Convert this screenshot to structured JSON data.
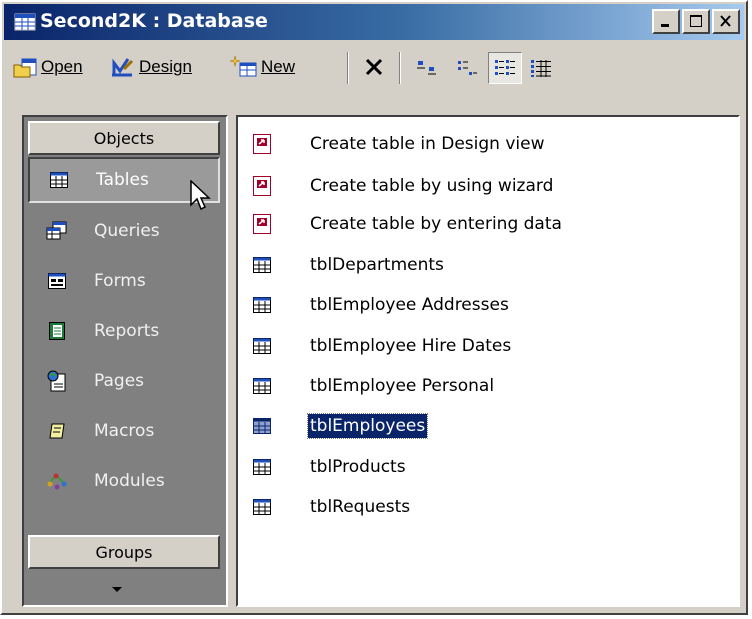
{
  "window": {
    "title": "Second2K : Database",
    "caption_buttons": [
      "minimize-icon",
      "maximize-icon",
      "close-icon"
    ]
  },
  "toolbar": {
    "open_label": "Open",
    "design_label": "Design",
    "new_label": "New",
    "active_view": "details-icon"
  },
  "objects_pane": {
    "header": "Objects",
    "items": [
      {
        "label": "Tables",
        "icon": "table-icon",
        "selected": true
      },
      {
        "label": "Queries",
        "icon": "query-icon"
      },
      {
        "label": "Forms",
        "icon": "form-icon"
      },
      {
        "label": "Reports",
        "icon": "report-icon"
      },
      {
        "label": "Pages",
        "icon": "page-icon"
      },
      {
        "label": "Macros",
        "icon": "macro-icon"
      },
      {
        "label": "Modules",
        "icon": "module-icon"
      }
    ],
    "groups_header": "Groups"
  },
  "list": {
    "items": [
      {
        "label": "Create table in Design view",
        "icon": "shortcut-icon"
      },
      {
        "label": "Create table by using wizard",
        "icon": "shortcut-icon"
      },
      {
        "label": "Create table by entering data",
        "icon": "shortcut-icon"
      },
      {
        "label": "tblDepartments",
        "icon": "table-icon"
      },
      {
        "label": "tblEmployee Addresses",
        "icon": "table-icon"
      },
      {
        "label": "tblEmployee Hire Dates",
        "icon": "table-icon"
      },
      {
        "label": "tblEmployee Personal",
        "icon": "table-icon"
      },
      {
        "label": "tblEmployees",
        "icon": "table-icon",
        "selected": true
      },
      {
        "label": "tblProducts",
        "icon": "table-icon"
      },
      {
        "label": "tblRequests",
        "icon": "table-icon"
      }
    ]
  },
  "colors": {
    "titlebar_start": "#0a246a",
    "titlebar_end": "#a6caf0",
    "selection": "#0a246a",
    "face": "#d4d0c8"
  }
}
